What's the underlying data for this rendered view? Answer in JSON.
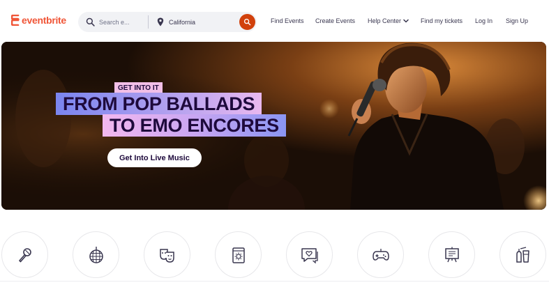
{
  "brand": {
    "logo_text": "eventbrite",
    "logo_color": "#f05537"
  },
  "search": {
    "placeholder": "Search e...",
    "location_value": "California",
    "button_color": "#d1410c"
  },
  "nav": {
    "find_events": "Find Events",
    "create_events": "Create Events",
    "help_center": "Help Center",
    "find_tickets": "Find my tickets",
    "log_in": "Log In",
    "sign_up": "Sign Up"
  },
  "hero": {
    "eyebrow": "GET INTO IT",
    "headline_line1": "FROM POP BALLADS",
    "headline_line2": "TO EMO ENCORES",
    "cta_label": "Get Into Live Music"
  },
  "categories": [
    {
      "icon": "microphone-icon"
    },
    {
      "icon": "disco-ball-icon"
    },
    {
      "icon": "theater-masks-icon"
    },
    {
      "icon": "holiday-calendar-icon"
    },
    {
      "icon": "dating-chat-icon"
    },
    {
      "icon": "game-controller-icon"
    },
    {
      "icon": "business-board-icon"
    },
    {
      "icon": "food-drink-icon"
    }
  ]
}
